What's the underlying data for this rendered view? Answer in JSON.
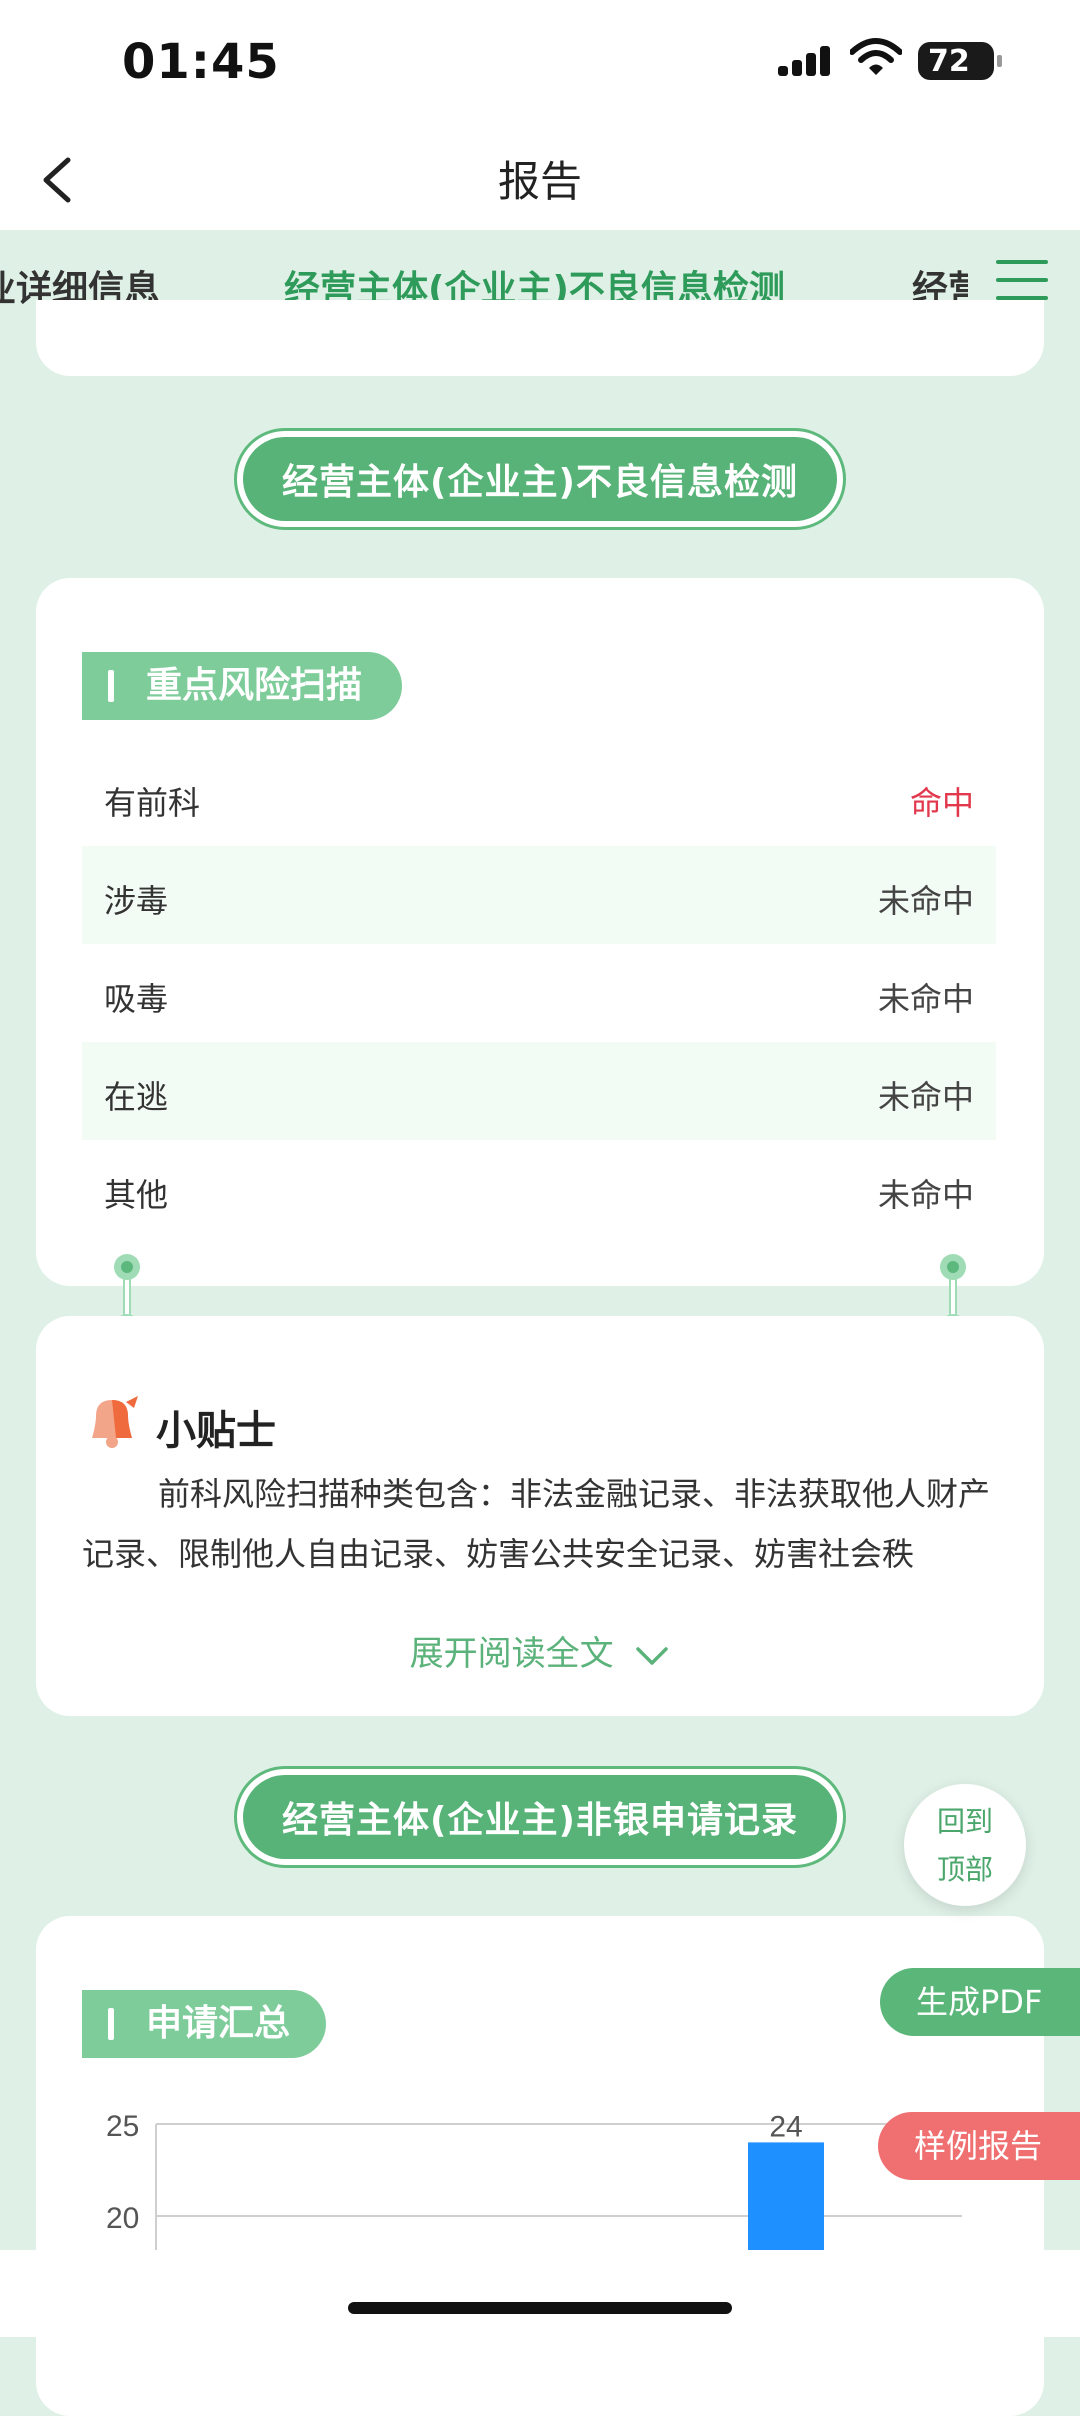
{
  "status_bar": {
    "time": "01:45",
    "battery": "72"
  },
  "nav": {
    "title": "报告"
  },
  "tabs": {
    "left": "业详细信息",
    "active": "经营主体(企业主)不良信息检测",
    "right": "经营"
  },
  "section1": {
    "button": "经营主体(企业主)不良信息检测",
    "tag": "重点风险扫描",
    "rows": [
      {
        "label": "有前科",
        "value": "命中",
        "status": "hit"
      },
      {
        "label": "涉毒",
        "value": "未命中",
        "status": "miss"
      },
      {
        "label": "吸毒",
        "value": "未命中",
        "status": "miss"
      },
      {
        "label": "在逃",
        "value": "未命中",
        "status": "miss"
      },
      {
        "label": "其他",
        "value": "未命中",
        "status": "miss"
      }
    ]
  },
  "tips": {
    "title": "小贴士",
    "body": "前科风险扫描种类包含：非法金融记录、非法获取他人财产记录、限制他人自由记录、妨害公共安全记录、妨害社会秩",
    "expand": "展开阅读全文"
  },
  "section2": {
    "button": "经营主体(企业主)非银申请记录",
    "tag": "申请汇总"
  },
  "chart_data": {
    "type": "bar",
    "yticks": [
      25,
      20
    ],
    "data_labels": [
      "24"
    ],
    "values": [
      24
    ],
    "bar_color": "#1e90ff"
  },
  "floating": {
    "back_top_line1": "回到",
    "back_top_line2": "顶部",
    "pdf": "生成PDF",
    "sample": "样例报告"
  },
  "colors": {
    "accent": "#57b377",
    "hit": "#e2384d",
    "background": "#dff1e7"
  }
}
